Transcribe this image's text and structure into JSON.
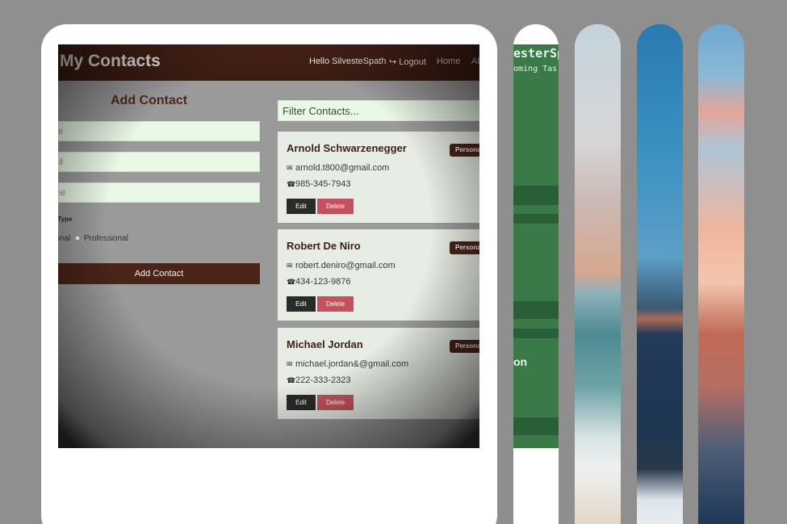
{
  "contacts_app": {
    "brand": "My Contacts",
    "nav": {
      "hello": "Hello SilvesteSpath",
      "logout": "Logout",
      "home": "Home",
      "about": "Ab"
    },
    "form": {
      "title": "Add Contact",
      "name_placeholder": "me",
      "email_placeholder": "ail",
      "phone_placeholder": "one",
      "type_label": "ct Type",
      "radio_personal": "rsonal",
      "radio_professional": "Professional",
      "submit_label": "Add Contact"
    },
    "filter_placeholder": "Filter Contacts...",
    "contacts": [
      {
        "name": "Arnold Schwarzenegger",
        "email": "arnold.t800@gmail.com",
        "phone": "985-345-7943",
        "type": "Personal"
      },
      {
        "name": "Robert De Niro",
        "email": "robert.deniro@gmail.com",
        "phone": "434-123-9876",
        "type": "Personal"
      },
      {
        "name": "Michael Jordan",
        "email": "michael.jordan&@gmail.com",
        "phone": "222-333-2323",
        "type": "Personal"
      }
    ],
    "edit_label": "Edit",
    "delete_label": "Delete"
  },
  "task_app_preview": {
    "title_fragment": "esterSp",
    "subtitle_fragment": "oming Tas",
    "section_fragment": "on"
  },
  "icons": {
    "logout": "sign-out-icon",
    "email": "envelope-icon",
    "phone": "phone-icon"
  },
  "colors": {
    "brand_brown": "#4a2418",
    "delete_red": "#c4525e",
    "input_green": "#eaf8e6",
    "task_green": "#3a7a49"
  }
}
